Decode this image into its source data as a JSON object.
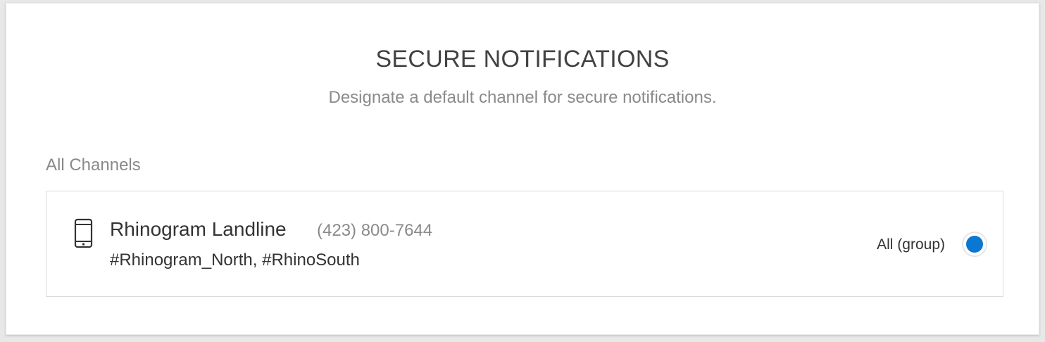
{
  "header": {
    "title": "SECURE NOTIFICATIONS",
    "subtitle": "Designate a default channel for secure notifications."
  },
  "channels_section": {
    "label": "All Channels",
    "items": [
      {
        "name": "Rhinogram Landline",
        "number": "(423) 800-7644",
        "tags": "#Rhinogram_North, #RhinoSouth",
        "option_label": "All (group)",
        "selected": true,
        "icon": "mobile-phone-icon"
      }
    ]
  },
  "colors": {
    "accent": "#0a78d2",
    "title_text": "#424242",
    "muted_text": "#8a8a8a"
  }
}
